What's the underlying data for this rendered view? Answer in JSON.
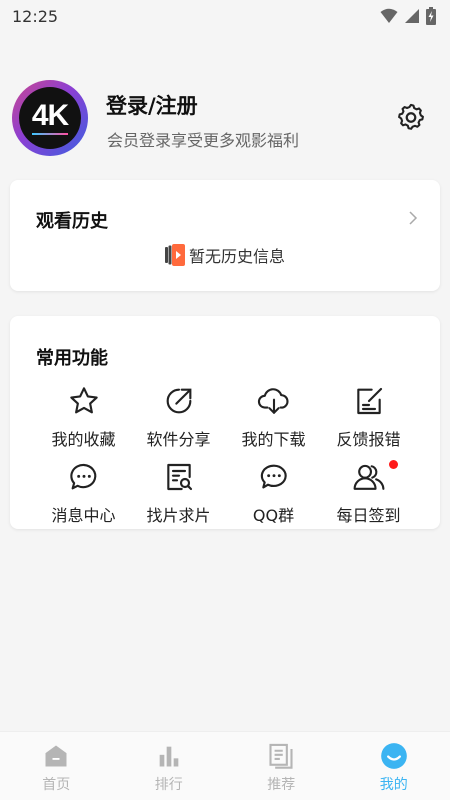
{
  "status": {
    "time": "12:25"
  },
  "profile": {
    "avatar_text": "4K",
    "title": "登录/注册",
    "subtitle": "会员登录享受更多观影福利"
  },
  "history": {
    "title": "观看历史",
    "empty_text": "暂无历史信息"
  },
  "functions": {
    "title": "常用功能",
    "items": [
      {
        "label": "我的收藏",
        "icon": "star-icon"
      },
      {
        "label": "软件分享",
        "icon": "share-icon"
      },
      {
        "label": "我的下载",
        "icon": "cloud-download-icon"
      },
      {
        "label": "反馈报错",
        "icon": "feedback-edit-icon"
      },
      {
        "label": "消息中心",
        "icon": "message-icon"
      },
      {
        "label": "找片求片",
        "icon": "search-document-icon"
      },
      {
        "label": "QQ群",
        "icon": "chat-group-icon"
      },
      {
        "label": "每日签到",
        "icon": "users-icon",
        "badge": true
      }
    ]
  },
  "tabbar": {
    "items": [
      {
        "label": "首页",
        "icon": "home-icon"
      },
      {
        "label": "排行",
        "icon": "bar-chart-icon"
      },
      {
        "label": "推荐",
        "icon": "recommend-icon"
      },
      {
        "label": "我的",
        "icon": "smile-icon",
        "active": true
      }
    ],
    "active_color": "#3bb4f2",
    "inactive_color": "#b5b5b5"
  }
}
